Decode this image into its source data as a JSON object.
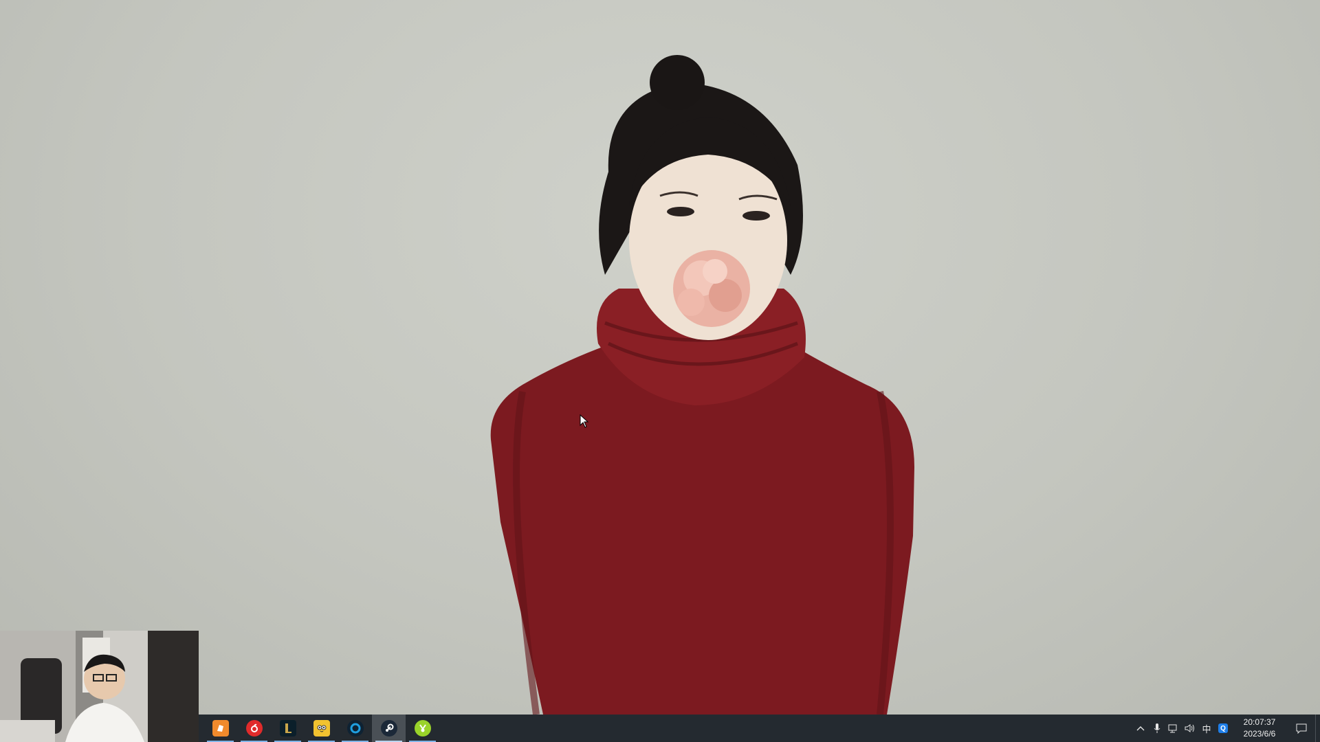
{
  "taskbar": {
    "apps": [
      {
        "name": "red-shoe-app-icon",
        "color": "#f08a2c"
      },
      {
        "name": "netease-music-icon",
        "color": "#e02b2b"
      },
      {
        "name": "league-of-legends-icon",
        "color": "#c9a64b"
      },
      {
        "name": "owl-app-icon",
        "color": "#f2c230"
      },
      {
        "name": "blue-ring-app-icon",
        "color": "#1f9fe0"
      },
      {
        "name": "steam-icon",
        "color": "#1b2838"
      },
      {
        "name": "green-ball-app-icon",
        "color": "#9ad32a"
      }
    ],
    "active_index": 5
  },
  "tray": {
    "ime_label": "中",
    "time": "20:07:37",
    "date": "2023/6/6"
  }
}
